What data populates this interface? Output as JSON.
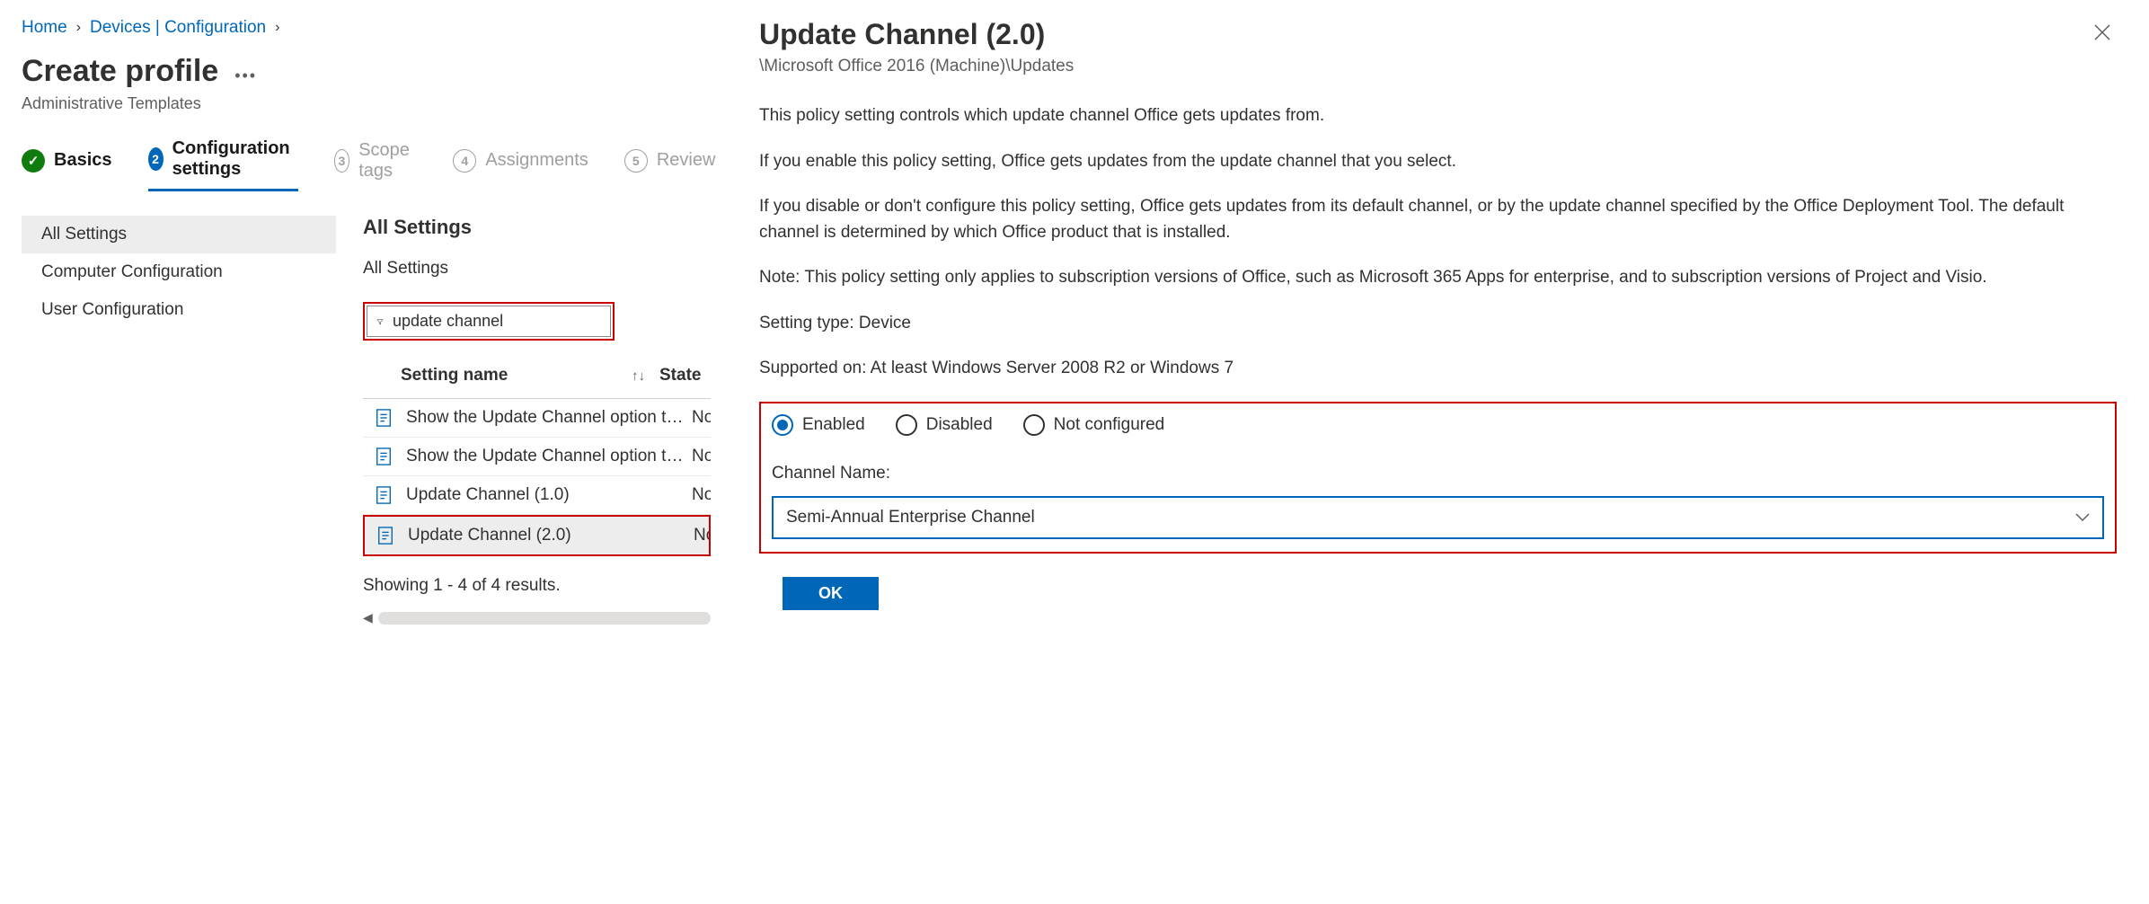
{
  "breadcrumb": {
    "items": [
      "Home",
      "Devices | Configuration"
    ]
  },
  "page": {
    "title": "Create profile",
    "subtitle": "Administrative Templates"
  },
  "steps": [
    {
      "label": "Basics"
    },
    {
      "label": "Configuration settings"
    },
    {
      "num": "3",
      "label": "Scope tags"
    },
    {
      "num": "4",
      "label": "Assignments"
    },
    {
      "num": "5",
      "label": "Review"
    }
  ],
  "sidenav": {
    "items": [
      "All Settings",
      "Computer Configuration",
      "User Configuration"
    ]
  },
  "main": {
    "heading": "All Settings",
    "subheading": "All Settings",
    "search_value": "update channel",
    "col_name": "Setting name",
    "col_state": "State",
    "rows": [
      {
        "name": "Show the Update Channel option to allo…",
        "state": "Not c"
      },
      {
        "name": "Show the Update Channel option to allo…",
        "state": "Not c"
      },
      {
        "name": "Update Channel (1.0)",
        "state": "Not c"
      },
      {
        "name": "Update Channel (2.0)",
        "state": "Not c"
      }
    ],
    "results_text": "Showing 1 - 4 of 4 results."
  },
  "panel": {
    "title": "Update Channel (2.0)",
    "path": "\\Microsoft Office 2016 (Machine)\\Updates",
    "desc1": "This policy setting controls which update channel Office gets updates from.",
    "desc2": "If you enable this policy setting, Office gets updates from the update channel that you select.",
    "desc3": "If you disable or don't configure this policy setting, Office gets updates from its default channel, or by the update channel specified by the Office Deployment Tool. The default channel is determined by which Office product that is installed.",
    "desc4": "Note: This policy setting only applies to subscription versions of Office, such as Microsoft 365 Apps for enterprise, and to subscription versions of Project and Visio.",
    "setting_type": "Setting type: Device",
    "supported_on": "Supported on: At least Windows Server 2008 R2 or Windows 7",
    "radios": {
      "enabled": "Enabled",
      "disabled": "Disabled",
      "not_configured": "Not configured"
    },
    "channel_label": "Channel Name:",
    "channel_value": "Semi-Annual Enterprise Channel",
    "ok": "OK"
  }
}
